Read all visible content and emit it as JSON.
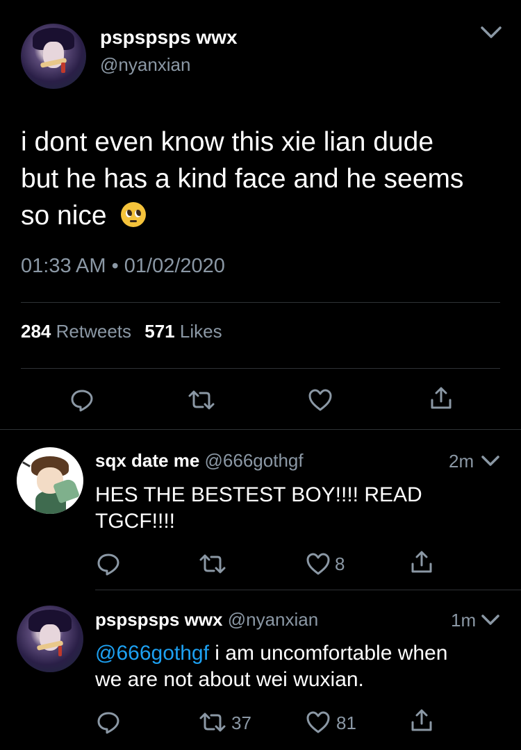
{
  "main_tweet": {
    "display_name": "pspspsps wwx",
    "handle": "@nyanxian",
    "text_line1": "i dont even know this xie lian dude",
    "text_line2": "but he has a kind face and he seems",
    "text_line3": "so nice",
    "emoji": "🥺",
    "timestamp": "01:33 AM • 01/02/2020",
    "retweets_count": "284",
    "retweets_label": "Retweets",
    "likes_count": "571",
    "likes_label": "Likes"
  },
  "replies": [
    {
      "display_name": "sqx date me",
      "handle": "@666gothgf",
      "time": "2m",
      "text_line1": "HES THE BESTEST BOY!!!! READ",
      "text_line2": "TGCF!!!!",
      "retweet_count": "",
      "like_count": "8"
    },
    {
      "display_name": "pspspsps wwx",
      "handle": "@nyanxian",
      "time": "1m",
      "mention": "@666gothgf",
      "text_line1_rest": " i am uncomfortable when",
      "text_line2": "we are not about wei wuxian.",
      "retweet_count": "37",
      "like_count": "81"
    }
  ],
  "colors": {
    "background": "#000000",
    "text": "#ffffff",
    "secondary": "#8b98a5",
    "link": "#1da1f2",
    "divider": "#2f3336"
  },
  "icons": [
    "reply-icon",
    "retweet-icon",
    "like-icon",
    "share-icon",
    "chevron-down-icon"
  ]
}
